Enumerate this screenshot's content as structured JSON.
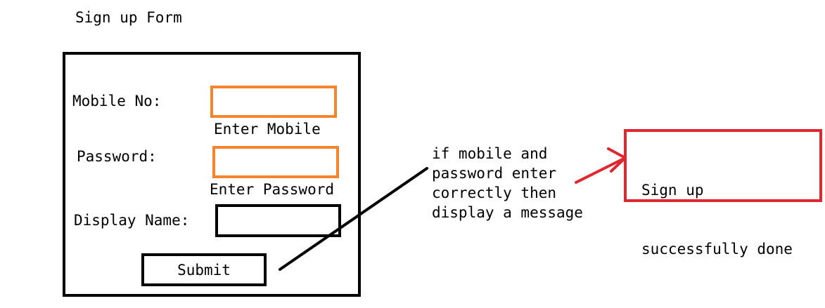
{
  "title": "Sign up Form",
  "form": {
    "mobile_label": "Mobile No:",
    "mobile_hint": "Enter Mobile",
    "password_label": "Password:",
    "password_hint": "Enter Password",
    "display_name_label": "Display Name:",
    "submit_label": "Submit"
  },
  "annotation": {
    "lines": [
      "if mobile and",
      "password enter",
      "correctly then",
      "display a message"
    ]
  },
  "success": {
    "lines": [
      "Sign up",
      "successfully done"
    ]
  },
  "colors": {
    "input_border": "#f5842c",
    "success_border": "#e0262f",
    "arrow": "#e0262f"
  }
}
